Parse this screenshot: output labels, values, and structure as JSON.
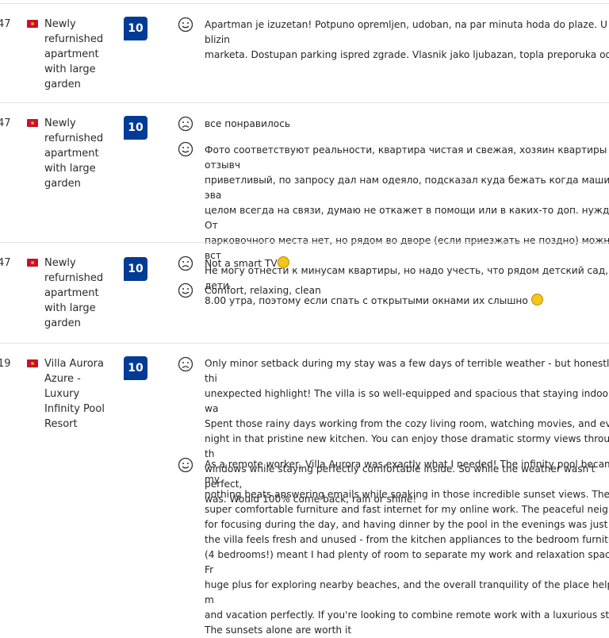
{
  "reviews": [
    {
      "row_number": "47",
      "property": "Newly\nrefurnished\napartment\nwith large\ngarden",
      "score": "10",
      "positive": "Apartman je izuzetan! Potpuno opremljen, udoban, na par minuta hoda do plaze. U blizin\nmarketa. Dostupan parking ispred zgrade. Vlasnik jako ljubazan, topla preporuka od nas"
    },
    {
      "row_number": "47",
      "property": "Newly\nrefurnished\napartment\nwith large\ngarden",
      "score": "10",
      "negative": "все понравилось",
      "positive": "Фото соответствуют реальности, квартира чистая и свежая, хозяин квартиры отзывч\nприветливый, по запросу дал нам одеяло, подсказал куда бежать когда машину эва\nцелом всегда на связи, думаю не откажет в помощи или в каких-то доп. нуждах. От\nпарковочного места нет, но рядом во дворе (если приезжать не поздно) можно вст\nНе могу отнести к минусам квартиры, но надо учесть, что рядом детский сад, и дети\n8.00 утра, поэтому если спать с открытыми окнами их слышно"
    },
    {
      "row_number": "47",
      "property": "Newly\nrefurnished\napartment\nwith large\ngarden",
      "score": "10",
      "negative": "Not a smart TV",
      "positive": "Comfort, relaxing, clean"
    },
    {
      "row_number": "19",
      "property": "Villa Aurora\nAzure -\nLuxury\nInfinity Pool\nResort",
      "score": "10",
      "negative": "Only minor setback during my stay was a few days of terrible weather - but honestly, thi\nunexpected highlight! The villa is so well-equipped and spacious that staying indoors wa\nSpent those rainy days working from the cozy living room, watching movies, and even h\nnight in that pristine new kitchen. You can enjoy those dramatic stormy views through th\nwindows while staying perfectly comfortable inside. So while the weather wasn't perfect,\nwas. Would 100% come back, rain or shine!",
      "positive": "As a remote worker, Villa Aurora was exactly what I needed! The infinity pool became my\nnothing beats answering emails while soaking in those incredible sunset views. The villa\nsuper comfortable furniture and fast internet for my online work. The peaceful neighbor\nfor focusing during the day, and having dinner by the pool in the evenings was just mag\nthe villa feels fresh and unused - from the kitchen appliances to the bedroom furniture. \n(4 bedrooms!) meant I had plenty of room to separate my work and relaxation spaces. Fr\nhuge plus for exploring nearby beaches, and the overall tranquility of the place helped m\nand vacation perfectly. If you're looking to combine remote work with a luxurious stay, t\nThe sunsets alone are worth it"
    }
  ],
  "icons": {
    "flag": "montenegro-flag-icon",
    "positive": "smiley-face-icon",
    "negative": "sad-face-icon",
    "score_color": "#003b95"
  }
}
